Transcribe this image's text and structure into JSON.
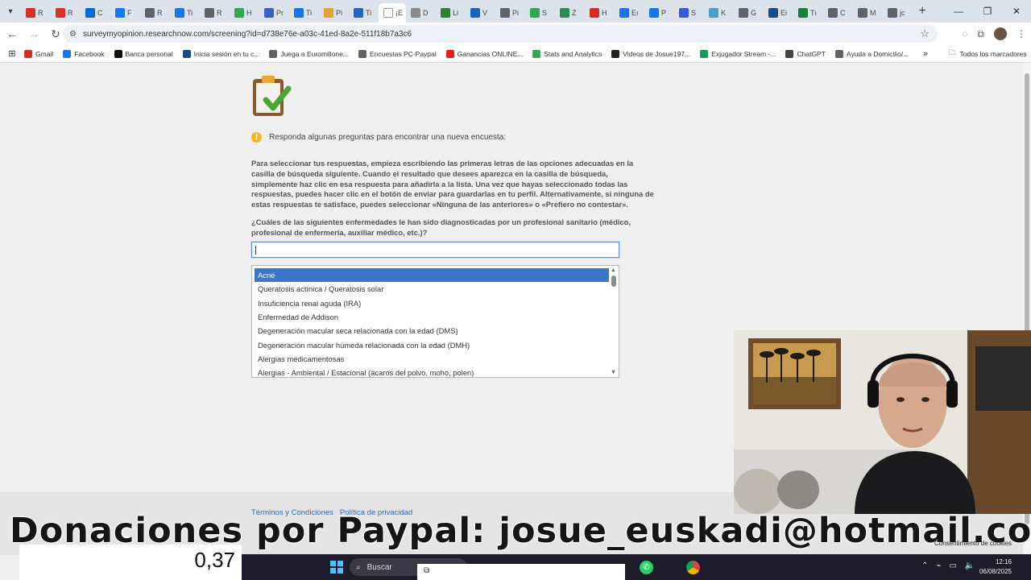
{
  "browser": {
    "tabs": [
      {
        "label": "R",
        "color": "#d93025"
      },
      {
        "label": "R",
        "color": "#d93025"
      },
      {
        "label": "C",
        "color": "#0b6bd6"
      },
      {
        "label": "F",
        "color": "#1877f2"
      },
      {
        "label": "R",
        "color": "#5f6368"
      },
      {
        "label": "Ti",
        "color": "#1a73e8"
      },
      {
        "label": "R",
        "color": "#5f6368"
      },
      {
        "label": "H",
        "color": "#34a853"
      },
      {
        "label": "Pr",
        "color": "#3b5fc0"
      },
      {
        "label": "Ti",
        "color": "#1a73e8"
      },
      {
        "label": "Pi",
        "color": "#e8a33a"
      },
      {
        "label": "Ti",
        "color": "#2a62c9"
      },
      {
        "label": "¡E",
        "color": "#ffffff",
        "active": true
      },
      {
        "label": "D",
        "color": "#8a8a8a"
      },
      {
        "label": "Li",
        "color": "#2e7d32"
      },
      {
        "label": "V",
        "color": "#1565c0"
      },
      {
        "label": "Pi",
        "color": "#5f6368"
      },
      {
        "label": "S",
        "color": "#33a852"
      },
      {
        "label": "Z",
        "color": "#2e8b57"
      },
      {
        "label": "H",
        "color": "#d62b2b"
      },
      {
        "label": "Eı",
        "color": "#1a73e8"
      },
      {
        "label": "P",
        "color": "#1a73e8"
      },
      {
        "label": "S",
        "color": "#3a57d6"
      },
      {
        "label": "K",
        "color": "#4aa0c8"
      },
      {
        "label": "G",
        "color": "#5f6368"
      },
      {
        "label": "Ei",
        "color": "#1a4a8a"
      },
      {
        "label": "Tı",
        "color": "#188038"
      },
      {
        "label": "C",
        "color": "#5f6368"
      },
      {
        "label": "M",
        "color": "#5f6368"
      },
      {
        "label": "jc",
        "color": "#5f6368"
      }
    ],
    "close_glyph": "✕",
    "new_tab_glyph": "+",
    "url": "surveymyopinion.researchnow.com/screening?id=d738e76e-a03c-41ed-8a2e-511f18b7a3c6",
    "bookmarks": [
      {
        "label": "Gmail",
        "color": "#d93025"
      },
      {
        "label": "Facebook",
        "color": "#1877f2"
      },
      {
        "label": "Banca personal",
        "color": "#111111"
      },
      {
        "label": "Inicia sesión en tu c...",
        "color": "#1a4a8a"
      },
      {
        "label": "Juega a Euromillone...",
        "color": "#5f6368"
      },
      {
        "label": "Encuestas PC-Paypal",
        "color": "#5f6368"
      },
      {
        "label": "Ganancias ONLINE...",
        "color": "#e62117"
      },
      {
        "label": "Stats and Analytics",
        "color": "#34a853"
      },
      {
        "label": "Videos de Josue197...",
        "color": "#222222"
      },
      {
        "label": "Exjugador Stream -...",
        "color": "#0f9d58"
      },
      {
        "label": "ChatGPT",
        "color": "#444444"
      },
      {
        "label": "Ayuda a Domicilio/...",
        "color": "#5f6368"
      }
    ],
    "bookmarks_all": "Todos los marcadores",
    "bookmarks_more": "»"
  },
  "survey": {
    "info_text": "Responda algunas preguntas para encontrar una nueva encuesta:",
    "instructions": "Para seleccionar tus respuestas, empieza escribiendo las primeras letras de las opciones adecuadas en la casilla de búsqueda siguiente. Cuando el resultado que desees aparezca en la casilla de búsqueda, simplemente haz clic en esa respuesta para añadirla a la lista. Una vez que hayas seleccionado todas las respuestas, puedes hacer clic en el botón de enviar para guardarlas en tu perfil. Alternativamente, si ninguna de estas respuestas te satisface, puedes seleccionar «Ninguna de las anteriores» o «Prefiero no contestar».",
    "question": "¿Cuáles de las siguientes enfermedades le han sido diagnosticadas por un profesional sanitario (médico, profesional de enfermería, auxiliar médico, etc.)?",
    "search_value": "",
    "options": [
      "Acné",
      "Queratosis actínica / Queratosis solar",
      "Insuficiencia renal aguda (IRA)",
      "Enfermedad de Addison",
      "Degeneración macular seca relacionada con la edad (DMS)",
      "Degeneración macular húmeda relacionada con la edad (DMH)",
      "Alergias medicamentosas",
      "Alergias - Ambiental / Estacional (ácaros del polvo, moho, polen)"
    ],
    "selected_option": "Acné",
    "footer_links": [
      "Términos y Condiciones",
      "Política de privacidad"
    ]
  },
  "overlay": {
    "donation_text": "Donaciones por Paypal: josue_euskadi@hotmail.com",
    "counter": "0,37",
    "cookie_label": "Consentimiento de cookies"
  },
  "taskbar": {
    "search_placeholder": "Buscar",
    "time": "12:16",
    "date": "06/08/2025"
  }
}
